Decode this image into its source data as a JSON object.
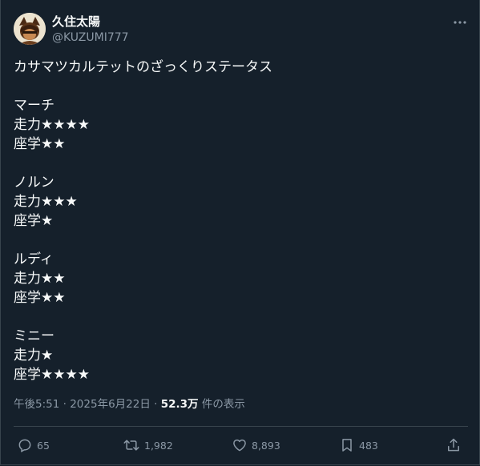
{
  "user": {
    "display_name": "久住太陽",
    "handle": "@KUZUMI777"
  },
  "tweet": {
    "lines": [
      "カサマツカルテットのざっくりステータス",
      "",
      "マーチ",
      "走力★★★★",
      "座学★★",
      "",
      "ノルン",
      "走力★★★",
      "座学★",
      "",
      "ルディ",
      "走力★★",
      "座学★★",
      "",
      "ミニー",
      "走力★",
      "座学★★★★"
    ]
  },
  "meta": {
    "time": "午後5:51",
    "separator": "·",
    "date": "2025年6月22日",
    "views_count": "52.3万",
    "views_label": "件の表示"
  },
  "actions": {
    "replies": "65",
    "retweets": "1,982",
    "likes": "8,893",
    "bookmarks": "483"
  },
  "colors": {
    "background": "#15202b",
    "text": "#f7f9f9",
    "secondary": "#8b98a5",
    "border": "#38444d"
  }
}
